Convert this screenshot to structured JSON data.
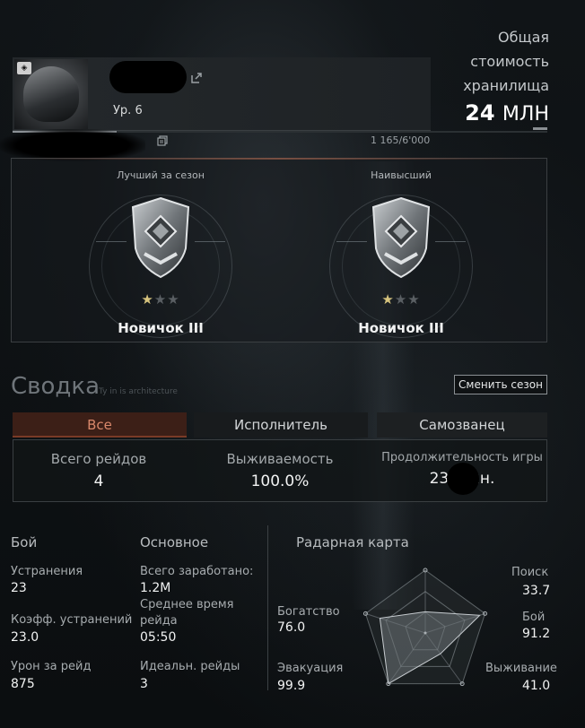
{
  "profile": {
    "level": "Ур. 6",
    "xp_text": "1 165/6'000",
    "xp_progress": 0.194
  },
  "stash": {
    "label_line1": "Общая",
    "label_line2": "стоимость",
    "label_line3": "хранилища",
    "value": "24",
    "unit": "МЛН"
  },
  "ranks": [
    {
      "title": "Лучший за сезон",
      "name": "Новичок III",
      "stars_filled": 1,
      "stars_total": 3
    },
    {
      "title": "Наивысший",
      "name": "Новичок III",
      "stars_filled": 1,
      "stars_total": 3
    }
  ],
  "summary": {
    "title": "Сводка",
    "subtitle": "Ty in is architecture",
    "change_season_label": "Сменить сезон",
    "tabs": [
      "Все",
      "Исполнитель",
      "Самозванец"
    ],
    "active_tab": "Все",
    "stats": {
      "total_raids_label": "Всего рейдов",
      "total_raids_value": "4",
      "survival_label": "Выживаемость",
      "survival_value": "100.0%",
      "playtime_label": "Продолжительность игры",
      "playtime_value": "23, мин."
    }
  },
  "combat": {
    "heading": "Бой",
    "kills_label": "Устранения",
    "kills_value": "23",
    "kill_ratio_label": "Коэфф. устранений",
    "kill_ratio_value": "23.0",
    "damage_label": "Урон за рейд",
    "damage_value": "875"
  },
  "basic": {
    "heading": "Основное",
    "earned_label": "Всего заработано:",
    "earned_value": "1.2M",
    "avg_time_label_1": "Среднее время",
    "avg_time_label_2": "рейда",
    "avg_time_value": "05:50",
    "perfect_label": "Идеальн. рейды",
    "perfect_value": "3"
  },
  "radar": {
    "heading": "Радарная карта",
    "axes": [
      {
        "label": "Поиск",
        "value": "33.7",
        "score": 33.7
      },
      {
        "label": "Бой",
        "value": "91.2",
        "score": 91.2
      },
      {
        "label": "Выживание",
        "value": "41.0",
        "score": 41.0
      },
      {
        "label": "Эвакуация",
        "value": "99.9",
        "score": 99.9
      },
      {
        "label": "Богатство",
        "value": "76.0",
        "score": 76.0
      }
    ]
  },
  "colors": {
    "accent": "#d9886b",
    "active_tab_bg": "#3c1f17",
    "star_on": "#d7c47e",
    "star_off": "#5a5f63"
  }
}
